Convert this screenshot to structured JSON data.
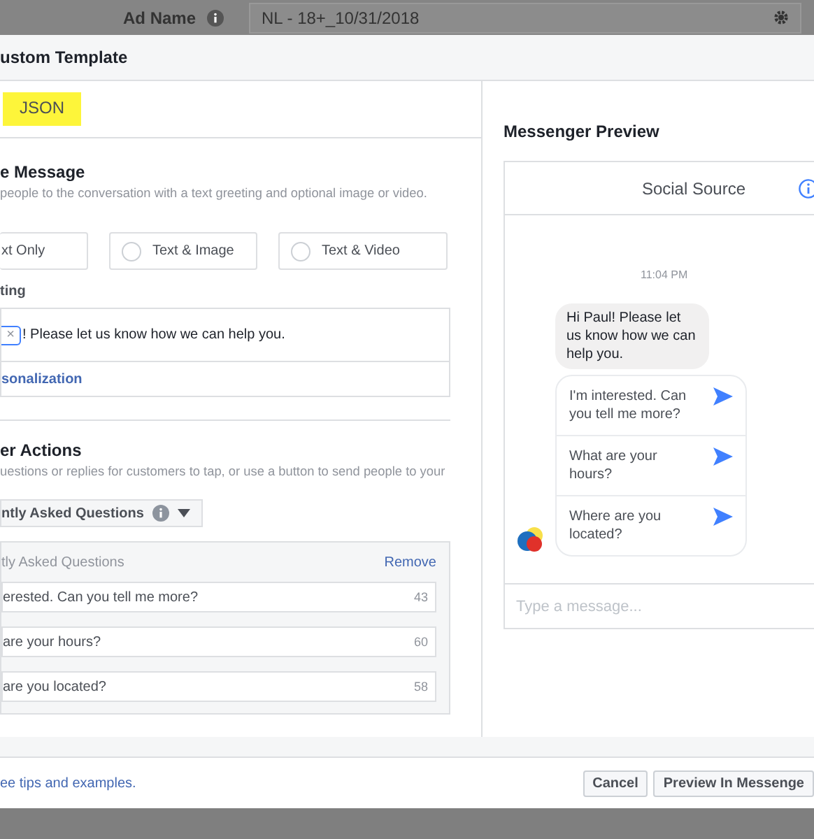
{
  "background": {
    "label": "Ad Name",
    "field_value": "NL - 18+_10/31/2018"
  },
  "dialog": {
    "title": "ustom Template"
  },
  "tabs": [
    {
      "label": "JSON",
      "selected": false,
      "highlighted": true
    }
  ],
  "message": {
    "title": "e Message",
    "description": "people to the conversation with a text greeting and optional image or video.",
    "options": [
      {
        "label": "xt Only"
      },
      {
        "label": "Text & Image",
        "selected": false
      },
      {
        "label": "Text & Video",
        "selected": false
      }
    ],
    "greeting_label": "ting",
    "greeting_text": "! Please let us know how we can help you.",
    "token_remove": "×",
    "personalization_link": "sonalization"
  },
  "actions": {
    "title": "er Actions",
    "description": "uestions or replies for customers to tap, or use a button to send people to your",
    "dropdown": "ntly Asked Questions",
    "panel_title": "tly Asked Questions",
    "remove_link": "Remove",
    "questions": [
      {
        "text": "erested. Can you tell me more?",
        "count": "43"
      },
      {
        "text": "are your hours?",
        "count": "60"
      },
      {
        "text": "are you located?",
        "count": "58"
      }
    ]
  },
  "preview": {
    "title": "Messenger Preview",
    "page_name": "Social Source",
    "time": "11:04 PM",
    "greeting": "Hi Paul! Please let us know how we can help you.",
    "quick_replies": [
      "I'm interested. Can you tell me more?",
      "What are your hours?",
      "Where are you located?"
    ],
    "placeholder": "Type a message..."
  },
  "footer": {
    "link": "ee tips and examples.",
    "buttons": [
      "Cancel",
      "Preview In Messenge"
    ]
  }
}
